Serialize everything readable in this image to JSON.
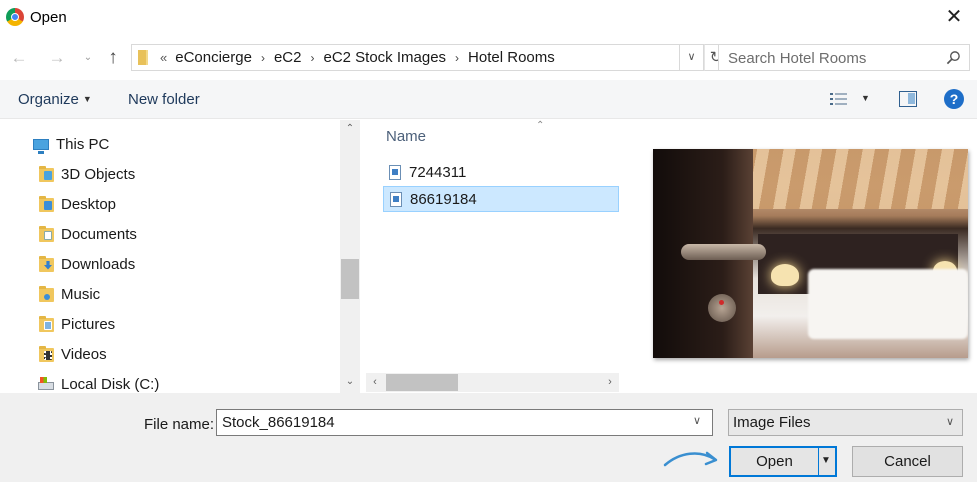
{
  "window": {
    "title": "Open",
    "app_icon": "chrome-icon"
  },
  "address": {
    "overflow": "«",
    "crumbs": [
      "eConcierge",
      "eC2",
      "eC2 Stock Images",
      "Hotel Rooms"
    ]
  },
  "search": {
    "placeholder": "Search Hotel Rooms"
  },
  "toolbar": {
    "organize": "Organize",
    "new_folder": "New folder",
    "help": "?"
  },
  "tree": {
    "items": [
      {
        "label": "This PC",
        "icon": "computer-icon"
      },
      {
        "label": "3D Objects",
        "icon": "folder-3d-objects-icon"
      },
      {
        "label": "Desktop",
        "icon": "folder-desktop-icon"
      },
      {
        "label": "Documents",
        "icon": "folder-documents-icon"
      },
      {
        "label": "Downloads",
        "icon": "folder-downloads-icon"
      },
      {
        "label": "Music",
        "icon": "folder-music-icon"
      },
      {
        "label": "Pictures",
        "icon": "folder-pictures-icon"
      },
      {
        "label": "Videos",
        "icon": "folder-videos-icon"
      },
      {
        "label": "Local Disk (C:)",
        "icon": "disk-icon"
      }
    ]
  },
  "files": {
    "column_header": "Name",
    "items": [
      {
        "name": "7244311",
        "selected": false
      },
      {
        "name": "86619184",
        "selected": true
      }
    ]
  },
  "bottom": {
    "file_name_label": "File name:",
    "file_name_value": "Stock_86619184",
    "file_type": "Image Files",
    "open_label": "Open",
    "cancel_label": "Cancel"
  },
  "colors": {
    "accent": "#0078d7",
    "selection": "#cce8ff"
  }
}
